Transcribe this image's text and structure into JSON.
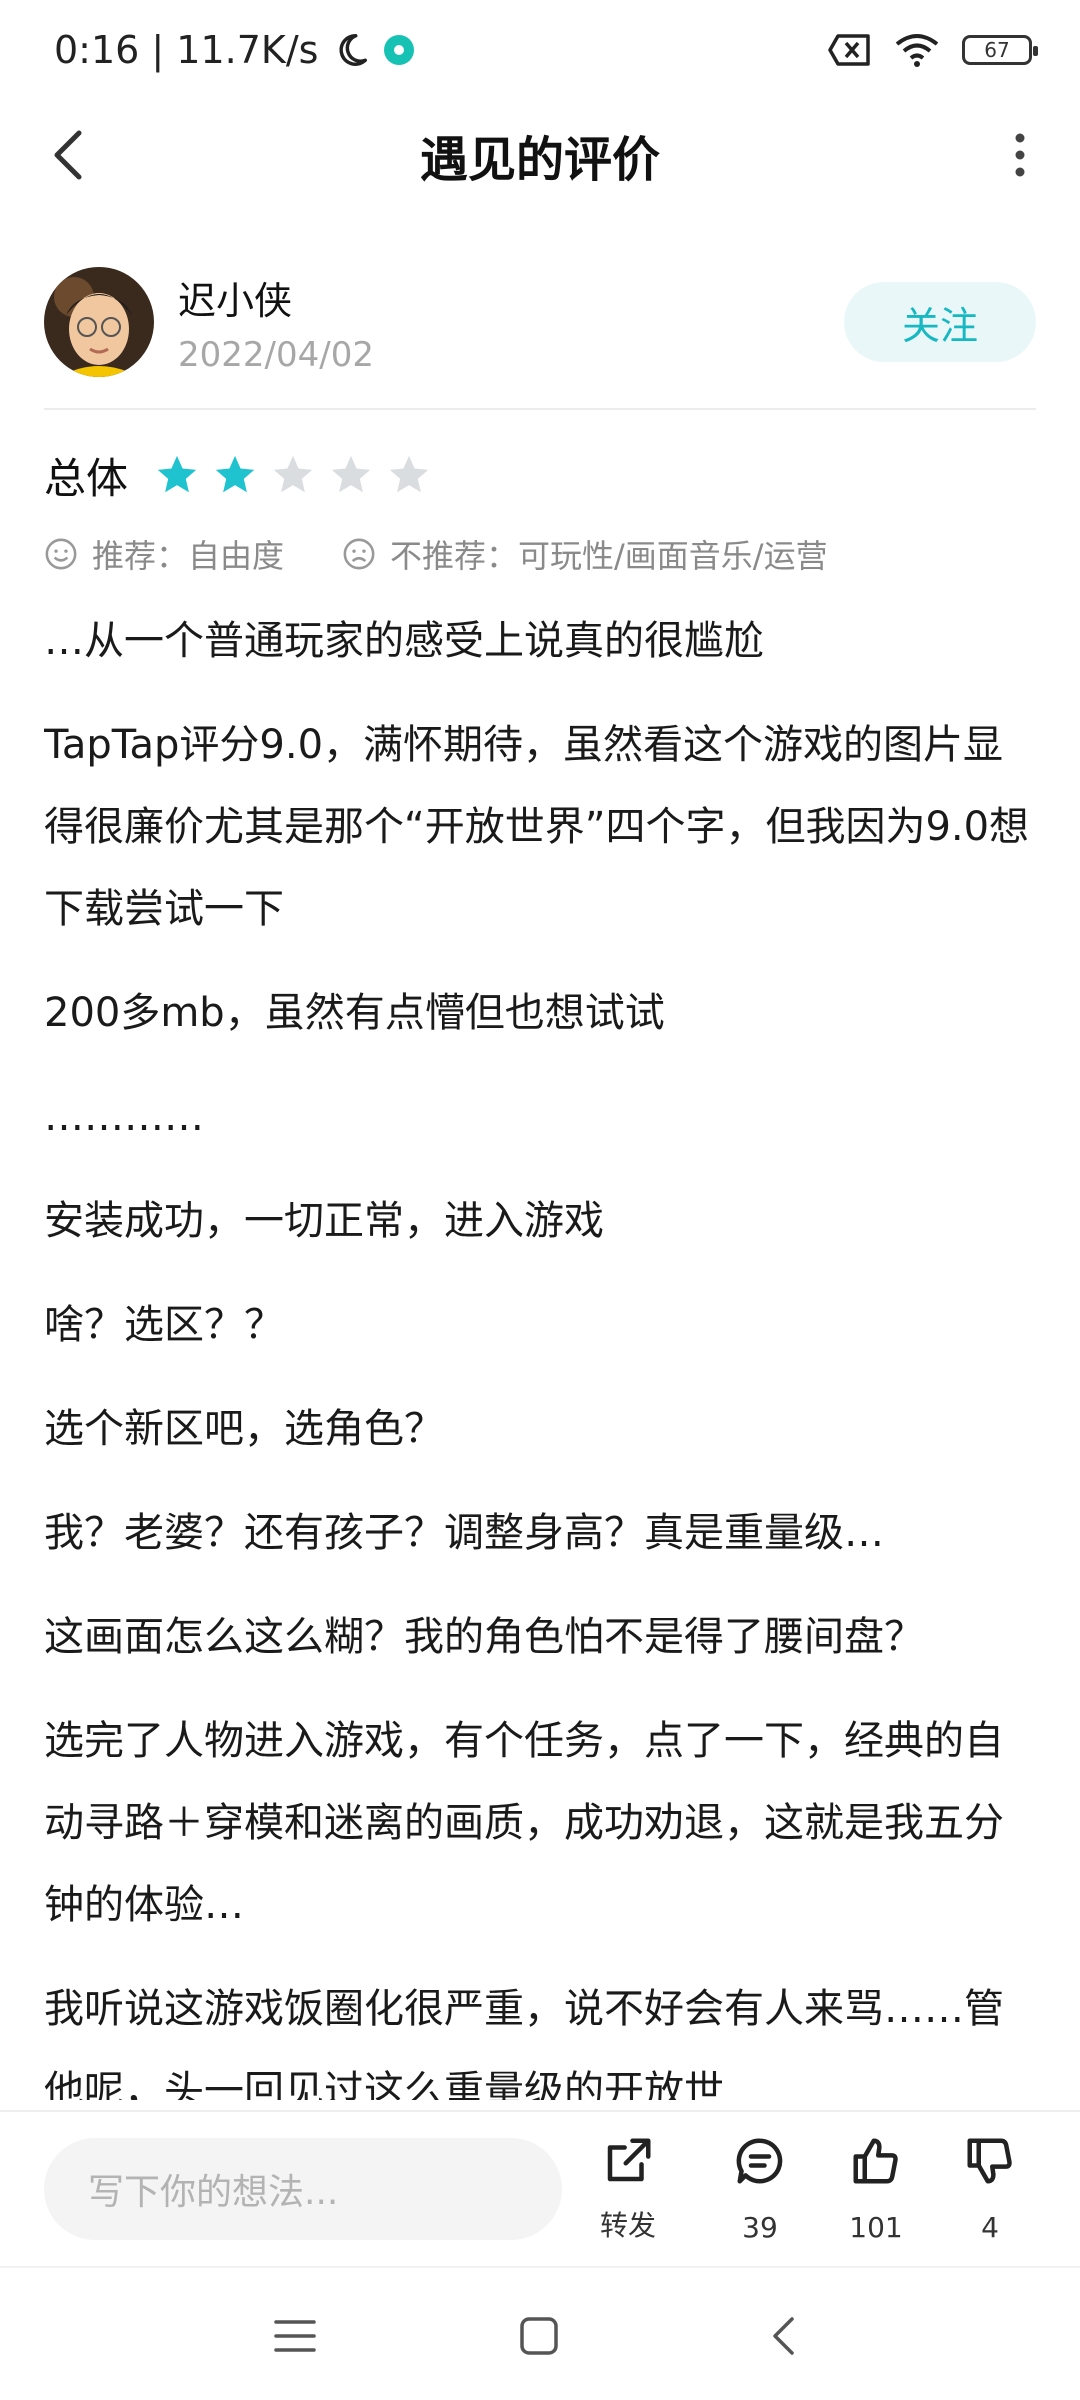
{
  "status_bar": {
    "time_speed": "0:16 | 11.7K/s",
    "battery": "67"
  },
  "header": {
    "title": "遇见的评价"
  },
  "author": {
    "name": "迟小侠",
    "date": "2022/04/02",
    "follow_label": "关注"
  },
  "rating": {
    "label": "总体",
    "stars_filled": 2,
    "stars_total": 5,
    "accent_color": "#1ec3cf"
  },
  "tags": {
    "recommend": "推荐：自由度",
    "not_recommend": "不推荐：可玩性/画面音乐/运营"
  },
  "review": {
    "paragraphs": [
      "…从一个普通玩家的感受上说真的很尴尬",
      "TapTap评分9.0，满怀期待，虽然看这个游戏的图片显得很廉价尤其是那个“开放世界”四个字，但我因为9.0想下载尝试一下",
      "200多mb，虽然有点懵但也想试试",
      "…………",
      "安装成功，一切正常，进入游戏",
      "啥？选区？？",
      "选个新区吧，选角色？",
      "我？老婆？还有孩子？调整身高？真是重量级…",
      "这画面怎么这么糊？我的角色怕不是得了腰间盘？",
      "选完了人物进入游戏，有个任务，点了一下，经典的自动寻路＋穿模和迷离的画质，成功劝退，这就是我五分钟的体验…",
      "我听说这游戏饭圈化很严重，说不好会有人来骂……管他呢，头一回见过这么重量级的开放世"
    ]
  },
  "actions": {
    "comment_placeholder": "写下你的想法...",
    "share_label": "转发",
    "comments_count": "39",
    "likes_count": "101",
    "dislikes_count": "4"
  }
}
